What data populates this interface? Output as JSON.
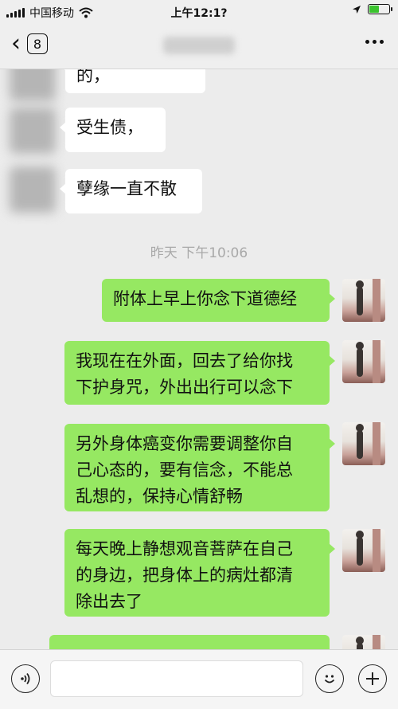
{
  "status_bar": {
    "carrier": "中国移动",
    "time": "上午12:1?",
    "icons": [
      "signal-bars-icon",
      "wifi-icon",
      "location-arrow-icon",
      "battery-icon"
    ],
    "battery_level": 0.55,
    "battery_color": "#3bc32f"
  },
  "nav": {
    "back_badge": "8",
    "icons": [
      "back-chevron-icon",
      "more-options-icon"
    ]
  },
  "messages": [
    {
      "direction": "incoming",
      "text": "的，"
    },
    {
      "direction": "incoming",
      "text": "受生债，"
    },
    {
      "direction": "incoming",
      "text": "孽缘一直不散"
    },
    {
      "type": "timestamp",
      "text": "昨天 下午10:06"
    },
    {
      "direction": "outgoing",
      "text": "附体上早上你念下道德经"
    },
    {
      "direction": "outgoing",
      "lines": [
        "我现在在外面，回去了给你找",
        "下护身咒，外出出行可以念下"
      ]
    },
    {
      "direction": "outgoing",
      "lines": [
        "另外身体癌变你需要调整你自",
        "己心态的，要有信念，不能总",
        "乱想的，保持心情舒畅"
      ]
    },
    {
      "direction": "outgoing",
      "lines": [
        "每天晚上静想观音菩萨在自己",
        "的身边，把身体上的病灶都清",
        "除出去了"
      ]
    }
  ],
  "input_bar": {
    "icons": [
      "voice-input-icon",
      "emoji-icon",
      "add-more-icon"
    ],
    "text_value": ""
  },
  "colors": {
    "outgoing_bubble": "#96e862",
    "incoming_bubble": "#ffffff",
    "chat_background": "#ececec"
  }
}
